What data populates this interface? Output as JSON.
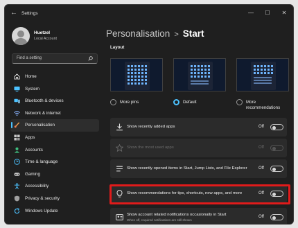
{
  "window": {
    "title": "Settings",
    "back_glyph": "←",
    "minimize_glyph": "—",
    "maximize_glyph": "☐",
    "close_glyph": "✕"
  },
  "user": {
    "name": "Huetzel",
    "account": "Local Account"
  },
  "search": {
    "placeholder": "Find a setting",
    "icon": "search-icon"
  },
  "nav": [
    {
      "label": "Home",
      "icon": "home-icon",
      "color": "#e8e8e8"
    },
    {
      "label": "System",
      "icon": "monitor-icon",
      "color": "#4cc2ff"
    },
    {
      "label": "Bluetooth & devices",
      "icon": "bluetooth-icon",
      "color": "#4cc2ff"
    },
    {
      "label": "Network & internet",
      "icon": "wifi-icon",
      "color": "#8ab4ff"
    },
    {
      "label": "Personalisation",
      "icon": "brush-icon",
      "color": "#f0a050",
      "active": true
    },
    {
      "label": "Apps",
      "icon": "apps-icon",
      "color": "#c8c8c8"
    },
    {
      "label": "Accounts",
      "icon": "person-icon",
      "color": "#3fbf7f"
    },
    {
      "label": "Time & language",
      "icon": "globe-clock-icon",
      "color": "#4cc2ff"
    },
    {
      "label": "Gaming",
      "icon": "gamepad-icon",
      "color": "#c8c8c8"
    },
    {
      "label": "Accessibility",
      "icon": "accessibility-icon",
      "color": "#4cc2ff"
    },
    {
      "label": "Privacy & security",
      "icon": "shield-icon",
      "color": "#a0a0a0"
    },
    {
      "label": "Windows Update",
      "icon": "update-icon",
      "color": "#4cc2ff"
    }
  ],
  "breadcrumb": {
    "parent": "Personalisation",
    "separator": ">",
    "current": "Start"
  },
  "layout": {
    "heading": "Layout",
    "options": [
      {
        "label": "More pins",
        "selected": false
      },
      {
        "label": "Default",
        "selected": true
      },
      {
        "label": "More recommendations",
        "selected": false
      }
    ]
  },
  "settings": [
    {
      "label": "Show recently added apps",
      "state": "Off",
      "icon": "download-icon",
      "enabled": true
    },
    {
      "label": "Show the most used apps",
      "state": "Off",
      "icon": "star-icon",
      "enabled": false
    },
    {
      "label": "Show recently opened items in Start, Jump Lists, and File Explorer",
      "state": "Off",
      "icon": "list-icon",
      "enabled": true
    },
    {
      "label": "Show recommendations for tips, shortcuts, new apps, and more",
      "state": "Off",
      "icon": "lightbulb-icon",
      "enabled": true,
      "highlighted": true
    },
    {
      "label": "Show account related notifications occasionally in Start",
      "sublabel": "When off, required notifications are still shown",
      "state": "Off",
      "icon": "person-card-icon",
      "enabled": true
    }
  ],
  "colors": {
    "accent": "#4cc2ff",
    "highlight_box": "#e01b1b",
    "window_bg": "#1f1f1f",
    "card_bg": "#2b2b2b"
  }
}
